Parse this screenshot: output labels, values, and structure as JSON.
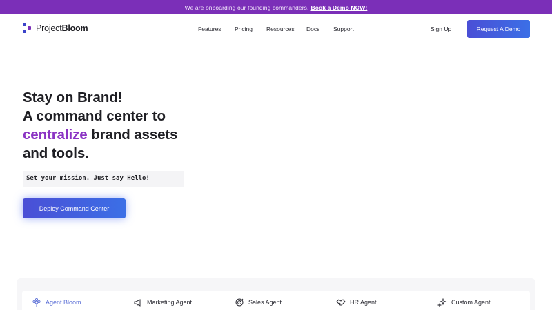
{
  "announcement": {
    "text": "We are onboarding our founding commanders.",
    "link": "Book a Demo NOW!"
  },
  "header": {
    "logo_light": "Project",
    "logo_bold": "Bloom",
    "nav": [
      "Features",
      "Pricing",
      "Resources",
      "Docs",
      "Support"
    ],
    "signup": "Sign Up",
    "demo_button": "Request A Demo"
  },
  "hero": {
    "line1": "Stay on Brand!",
    "line2": "A command center to",
    "accent_word": "centralize",
    "line3_rest": " brand assets",
    "line4": "and tools.",
    "mission_text": "Set your mission. Just say Hello!",
    "cta": "Deploy Command Center"
  },
  "agents": {
    "tabs": [
      {
        "label": "Agent Bloom",
        "icon": "flower-icon",
        "active": true
      },
      {
        "label": "Marketing Agent",
        "icon": "megaphone-icon",
        "active": false
      },
      {
        "label": "Sales Agent",
        "icon": "target-icon",
        "active": false
      },
      {
        "label": "HR Agent",
        "icon": "handshake-icon",
        "active": false
      },
      {
        "label": "Custom Agent",
        "icon": "sparkle-icon",
        "active": false
      }
    ]
  },
  "colors": {
    "brand_purple": "#7b2fb8",
    "accent_purple": "#8b34c4",
    "button_blue": "#4a4fd6",
    "active_tab": "#5b6fd6"
  }
}
